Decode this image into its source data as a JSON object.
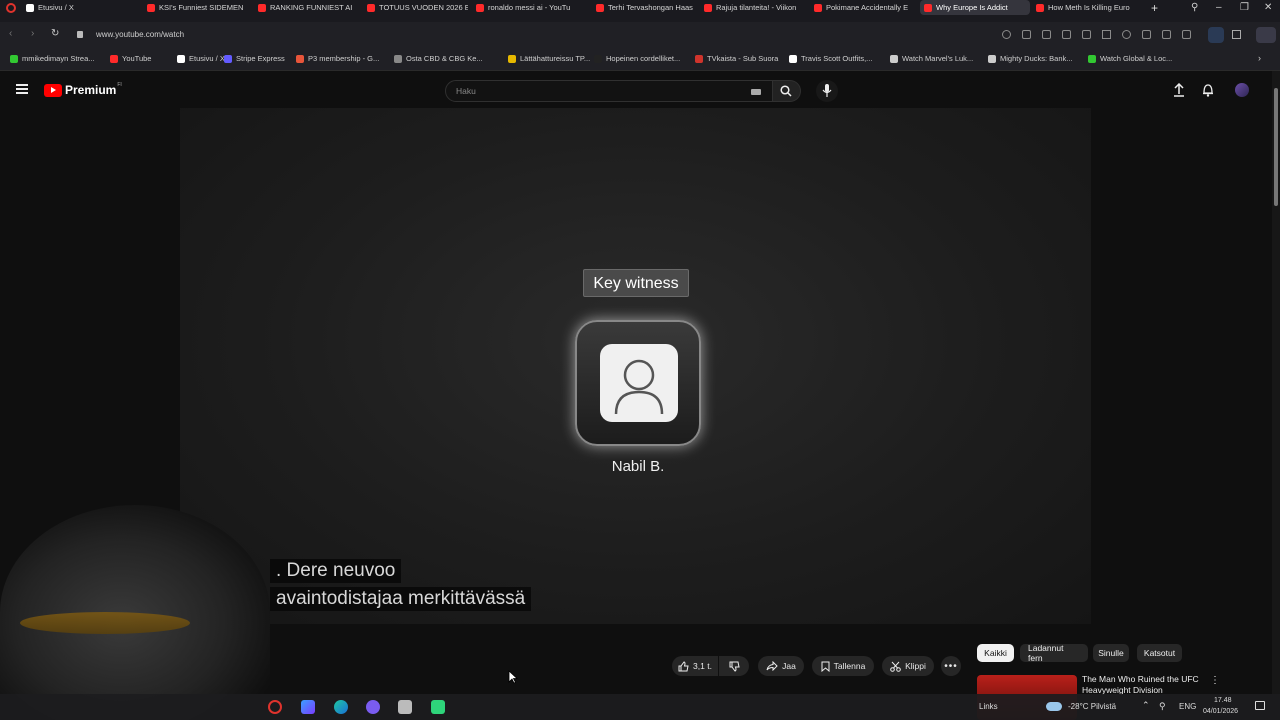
{
  "browser": {
    "tabs": [
      {
        "label": "Etusivu / X",
        "color": "#ffffff"
      },
      {
        "label": "KSI's Funniest SIDEMEN",
        "color": "#ff2a2a"
      },
      {
        "label": "RANKING FUNNIEST AI R",
        "color": "#ff2a2a"
      },
      {
        "label": "TOTUUS VUODEN 2026 E",
        "color": "#ff2a2a"
      },
      {
        "label": "ronaldo messi ai - YouTu",
        "color": "#ff2a2a"
      },
      {
        "label": "Terhi Tervashongan Haas",
        "color": "#ff2a2a"
      },
      {
        "label": "Rajuja tilanteita! - Viikon",
        "color": "#ff2a2a"
      },
      {
        "label": "Pokimane Accidentally E",
        "color": "#ff2a2a"
      },
      {
        "label": "Why Europe Is Addict",
        "color": "#ff2a2a"
      },
      {
        "label": "How Meth Is Killing Euro",
        "color": "#ff2a2a"
      }
    ],
    "new_tab": "+",
    "url": "www.youtube.com/watch",
    "bookmarks": [
      {
        "label": "mmikedimayn Strea...",
        "color": "#32c832"
      },
      {
        "label": "YouTube",
        "color": "#ff2a2a"
      },
      {
        "label": "Etusivu / X",
        "color": "#ffffff"
      },
      {
        "label": "Stripe Express",
        "color": "#635bff"
      },
      {
        "label": "P3 membership - G...",
        "color": "#e8553a"
      },
      {
        "label": "Osta CBD & CBG Ke...",
        "color": "#888888"
      },
      {
        "label": "Lättähattureissu TP...",
        "color": "#e6b800"
      },
      {
        "label": "Hopeinen cordelliket...",
        "color": "#222222"
      },
      {
        "label": "TVkaista - Sub Suora",
        "color": "#d0342c"
      },
      {
        "label": "Travis Scott Outfits,...",
        "color": "#ffffff"
      },
      {
        "label": "Watch Marvel's Luk...",
        "color": "#cccccc"
      },
      {
        "label": "Mighty Ducks: Bank...",
        "color": "#cccccc"
      },
      {
        "label": "Watch Global & Loc...",
        "color": "#32c832"
      }
    ]
  },
  "youtube": {
    "logo_text": "Premium",
    "logo_sup": "FI",
    "search_placeholder": "Haku"
  },
  "video": {
    "tag": "Key witness",
    "name": "Nabil B.",
    "caption_line1": ". Dere neuvoo",
    "caption_line2": "avaintodistajaa merkittävässä"
  },
  "actions": {
    "likes": "3,1 t.",
    "share": "Jaa",
    "save": "Tallenna",
    "clip": "Klippi"
  },
  "chips": [
    "Kaikki",
    "Ladannut fern",
    "Sinulle",
    "Katsotut"
  ],
  "recommendation": {
    "title": "The Man Who Ruined the UFC Heavyweight Division"
  },
  "taskbar": {
    "links": "Links",
    "weather": "-28°C Pilvistä",
    "lang": "ENG",
    "time": "17.48",
    "date": "04/01/2026"
  },
  "colors": {
    "brand_red": "#ff0000",
    "bg": "#0f0f0f"
  }
}
